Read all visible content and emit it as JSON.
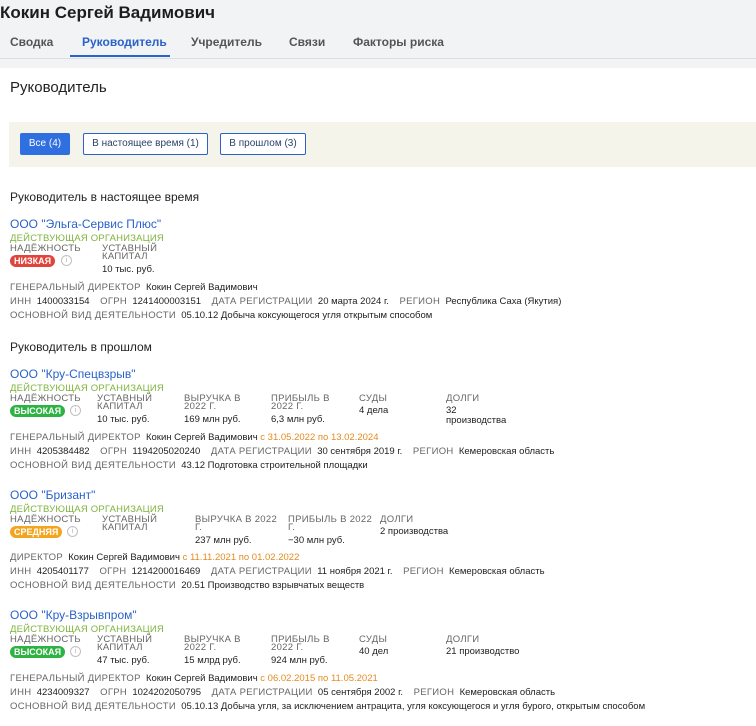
{
  "header": {
    "title": "Кокин Сергей Вадимович"
  },
  "tabs": [
    {
      "label": "Сводка"
    },
    {
      "label": "Руководитель"
    },
    {
      "label": "Учредитель"
    },
    {
      "label": "Связи"
    },
    {
      "label": "Факторы риска"
    }
  ],
  "main": {
    "heading": "Руководитель",
    "filters": [
      {
        "label": "Все (4)"
      },
      {
        "label": "В настоящее время (1)"
      },
      {
        "label": "В прошлом (3)"
      }
    ],
    "section_present": "Руководитель в настоящее время",
    "section_past": "Руководитель в прошлом"
  },
  "labels": {
    "reliability": "НАДЁЖНОСТЬ",
    "capital": "УСТАВНЫЙ КАПИТАЛ",
    "revenue": "ВЫРУЧКА В 2022 Г.",
    "profit": "ПРИБЫЛЬ В 2022 Г.",
    "courts": "СУДЫ",
    "debts": "ДОЛГИ",
    "inn": "ИНН",
    "ogrn": "ОГРН",
    "reg_date": "ДАТА РЕГИСТРАЦИИ",
    "region": "РЕГИОН",
    "activity": "ОСНОВНОЙ ВИД ДЕЯТЕЛЬНОСТИ"
  },
  "colors": {
    "accent": "#2a62c9",
    "status": "#7fb33c",
    "low": "#e0443a",
    "high": "#2db342",
    "medium": "#f3a51f",
    "date_range": "#e58a1e"
  },
  "present_orgs": [
    {
      "name": "ООО \"Эльга-Сервис Плюс\"",
      "status": "ДЕЙСТВУЮЩАЯ ОРГАНИЗАЦИЯ",
      "reliability": "НИЗКАЯ",
      "capital": "10 тыс. руб.",
      "role": "ГЕНЕРАЛЬНЫЙ ДИРЕКТОР",
      "person": "Кокин Сергей Вадимович",
      "inn": "1400033154",
      "ogrn": "1241400003151",
      "reg_date": "20 марта 2024 г.",
      "region": "Республика Саха (Якутия)",
      "activity": "05.10.12 Добыча коксующегося угля открытым способом"
    }
  ],
  "past_orgs": [
    {
      "name": "ООО \"Кру-Спецвзрыв\"",
      "status": "ДЕЙСТВУЮЩАЯ ОРГАНИЗАЦИЯ",
      "reliability": "ВЫСОКАЯ",
      "capital": "10 тыс. руб.",
      "revenue": "169 млн руб.",
      "profit": "6,3 млн руб.",
      "courts": "4 дела",
      "debts": "32 производства",
      "role": "ГЕНЕРАЛЬНЫЙ ДИРЕКТОР",
      "person": "Кокин Сергей Вадимович",
      "period": "с 31.05.2022 по 13.02.2024",
      "inn": "4205384482",
      "ogrn": "1194205020240",
      "reg_date": "30 сентября 2019 г.",
      "region": "Кемеровская область",
      "activity": "43.12 Подготовка строительной площадки"
    },
    {
      "name": "ООО \"Бризант\"",
      "status": "ДЕЙСТВУЮЩАЯ ОРГАНИЗАЦИЯ",
      "reliability": "СРЕДНЯЯ",
      "capital": "",
      "revenue": "237 млн руб.",
      "profit": "−30 млн руб.",
      "debts": "2 производства",
      "role": "ДИРЕКТОР",
      "person": "Кокин Сергей Вадимович",
      "period": "с 11.11.2021 по 01.02.2022",
      "inn": "4205401177",
      "ogrn": "1214200016469",
      "reg_date": "11 ноября 2021 г.",
      "region": "Кемеровская область",
      "activity": "20.51 Производство взрывчатых веществ"
    },
    {
      "name": "ООО \"Кру-Взрывпром\"",
      "status": "ДЕЙСТВУЮЩАЯ ОРГАНИЗАЦИЯ",
      "reliability": "ВЫСОКАЯ",
      "capital": "47 тыс. руб.",
      "revenue": "15 млрд руб.",
      "profit": "924 млн руб.",
      "courts": "40 дел",
      "debts": "21 производство",
      "role": "ГЕНЕРАЛЬНЫЙ ДИРЕКТОР",
      "person": "Кокин Сергей Вадимович",
      "period": "с 06.02.2015 по 11.05.2021",
      "inn": "4234009327",
      "ogrn": "1024202050795",
      "reg_date": "05 сентября 2002 г.",
      "region": "Кемеровская область",
      "activity": "05.10.13 Добыча угля, за исключением антрацита, угля коксующегося и угля бурого, открытым способом"
    }
  ]
}
